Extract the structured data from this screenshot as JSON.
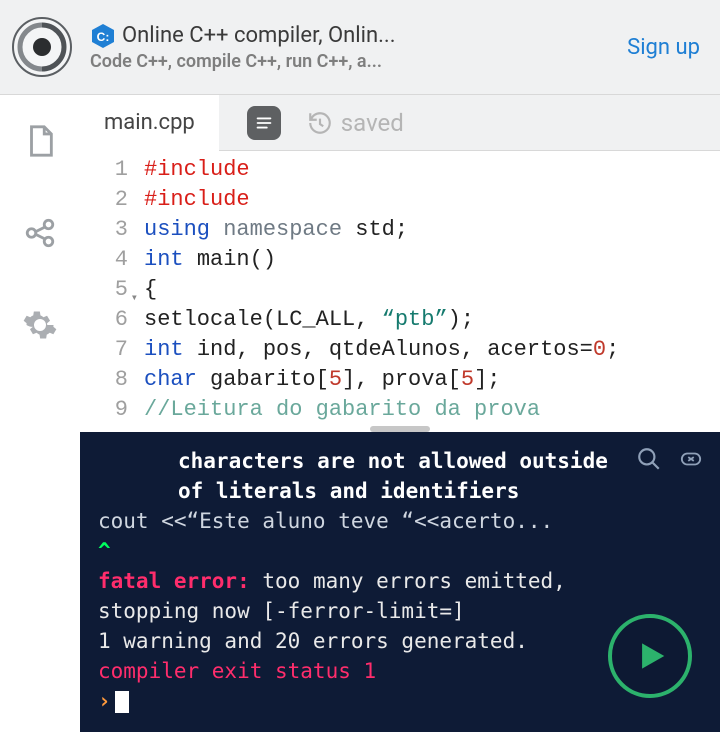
{
  "header": {
    "title": "Online C++ compiler, Onlin...",
    "subtitle": "Code C++, compile C++, run C++, a...",
    "signup_label": "Sign up",
    "cpp_badge": "C:"
  },
  "tabs": {
    "file_name": "main.cpp",
    "saved_label": "saved"
  },
  "editor": {
    "lines": [
      {
        "n": "1",
        "tokens": [
          [
            "k-red",
            "#include"
          ]
        ]
      },
      {
        "n": "2",
        "tokens": [
          [
            "k-red",
            "#include"
          ]
        ]
      },
      {
        "n": "3",
        "tokens": [
          [
            "k-blue",
            "using "
          ],
          [
            "k-gray",
            "namespace "
          ],
          [
            "k-text",
            "std;"
          ]
        ]
      },
      {
        "n": "4",
        "tokens": [
          [
            "k-blue",
            "int "
          ],
          [
            "k-text",
            "main()"
          ]
        ]
      },
      {
        "n": "5",
        "fold": true,
        "tokens": [
          [
            "k-text",
            "{"
          ]
        ]
      },
      {
        "n": "6",
        "tokens": [
          [
            "k-text",
            "setlocale(LC_ALL, "
          ],
          [
            "k-teal",
            "“ptb”"
          ],
          [
            "k-text",
            ");"
          ]
        ]
      },
      {
        "n": "7",
        "tokens": [
          [
            "k-blue",
            "int "
          ],
          [
            "k-text",
            "ind, pos, qtdeAlunos, acertos="
          ],
          [
            "k-num",
            "0"
          ],
          [
            "k-text",
            ";"
          ]
        ]
      },
      {
        "n": "8",
        "tokens": [
          [
            "k-blue",
            "char "
          ],
          [
            "k-text",
            "gabarito["
          ],
          [
            "k-num",
            "5"
          ],
          [
            "k-text",
            "], prova["
          ],
          [
            "k-num",
            "5"
          ],
          [
            "k-text",
            "];"
          ]
        ]
      },
      {
        "n": "9",
        "tokens": [
          [
            "k-comment",
            "//Leitura do gabarito da prova"
          ]
        ]
      }
    ]
  },
  "console": {
    "err1": "characters are not allowed outside",
    "err2": "of literals and identifiers",
    "src": "cout <<“Este aluno teve “<<acerto...",
    "caret": "        ^",
    "fatal_label": "fatal ",
    "error_label": "error: ",
    "fatal_msg1": "too many errors emitted,",
    "fatal_msg2": "        stopping now [-ferror-limit=]",
    "summary": "1 warning and 20 errors generated.",
    "exit": "compiler exit status 1",
    "prompt": "›"
  },
  "icons": {
    "file": "file-icon",
    "share": "share-icon",
    "settings": "gear-icon",
    "history": "history-icon",
    "search": "search-icon",
    "close": "close-icon",
    "run": "play-icon",
    "menu": "menu-icon",
    "logo": "swirl-logo"
  }
}
